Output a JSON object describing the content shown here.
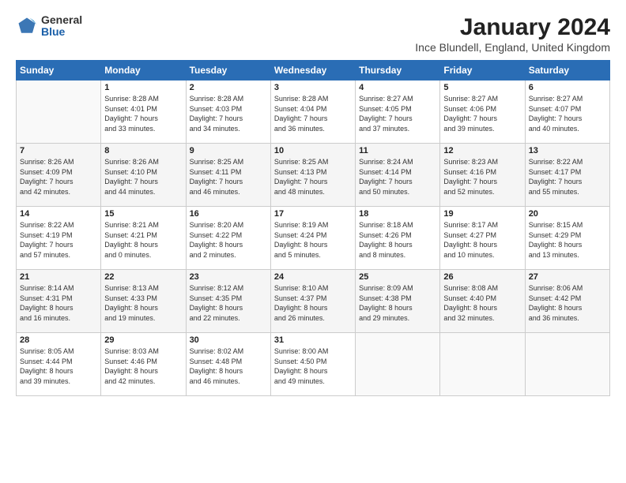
{
  "header": {
    "logo_general": "General",
    "logo_blue": "Blue",
    "title": "January 2024",
    "subtitle": "Ince Blundell, England, United Kingdom"
  },
  "days_of_week": [
    "Sunday",
    "Monday",
    "Tuesday",
    "Wednesday",
    "Thursday",
    "Friday",
    "Saturday"
  ],
  "weeks": [
    [
      {
        "day": "",
        "content": ""
      },
      {
        "day": "1",
        "content": "Sunrise: 8:28 AM\nSunset: 4:01 PM\nDaylight: 7 hours\nand 33 minutes."
      },
      {
        "day": "2",
        "content": "Sunrise: 8:28 AM\nSunset: 4:03 PM\nDaylight: 7 hours\nand 34 minutes."
      },
      {
        "day": "3",
        "content": "Sunrise: 8:28 AM\nSunset: 4:04 PM\nDaylight: 7 hours\nand 36 minutes."
      },
      {
        "day": "4",
        "content": "Sunrise: 8:27 AM\nSunset: 4:05 PM\nDaylight: 7 hours\nand 37 minutes."
      },
      {
        "day": "5",
        "content": "Sunrise: 8:27 AM\nSunset: 4:06 PM\nDaylight: 7 hours\nand 39 minutes."
      },
      {
        "day": "6",
        "content": "Sunrise: 8:27 AM\nSunset: 4:07 PM\nDaylight: 7 hours\nand 40 minutes."
      }
    ],
    [
      {
        "day": "7",
        "content": "Sunrise: 8:26 AM\nSunset: 4:09 PM\nDaylight: 7 hours\nand 42 minutes."
      },
      {
        "day": "8",
        "content": "Sunrise: 8:26 AM\nSunset: 4:10 PM\nDaylight: 7 hours\nand 44 minutes."
      },
      {
        "day": "9",
        "content": "Sunrise: 8:25 AM\nSunset: 4:11 PM\nDaylight: 7 hours\nand 46 minutes."
      },
      {
        "day": "10",
        "content": "Sunrise: 8:25 AM\nSunset: 4:13 PM\nDaylight: 7 hours\nand 48 minutes."
      },
      {
        "day": "11",
        "content": "Sunrise: 8:24 AM\nSunset: 4:14 PM\nDaylight: 7 hours\nand 50 minutes."
      },
      {
        "day": "12",
        "content": "Sunrise: 8:23 AM\nSunset: 4:16 PM\nDaylight: 7 hours\nand 52 minutes."
      },
      {
        "day": "13",
        "content": "Sunrise: 8:22 AM\nSunset: 4:17 PM\nDaylight: 7 hours\nand 55 minutes."
      }
    ],
    [
      {
        "day": "14",
        "content": "Sunrise: 8:22 AM\nSunset: 4:19 PM\nDaylight: 7 hours\nand 57 minutes."
      },
      {
        "day": "15",
        "content": "Sunrise: 8:21 AM\nSunset: 4:21 PM\nDaylight: 8 hours\nand 0 minutes."
      },
      {
        "day": "16",
        "content": "Sunrise: 8:20 AM\nSunset: 4:22 PM\nDaylight: 8 hours\nand 2 minutes."
      },
      {
        "day": "17",
        "content": "Sunrise: 8:19 AM\nSunset: 4:24 PM\nDaylight: 8 hours\nand 5 minutes."
      },
      {
        "day": "18",
        "content": "Sunrise: 8:18 AM\nSunset: 4:26 PM\nDaylight: 8 hours\nand 8 minutes."
      },
      {
        "day": "19",
        "content": "Sunrise: 8:17 AM\nSunset: 4:27 PM\nDaylight: 8 hours\nand 10 minutes."
      },
      {
        "day": "20",
        "content": "Sunrise: 8:15 AM\nSunset: 4:29 PM\nDaylight: 8 hours\nand 13 minutes."
      }
    ],
    [
      {
        "day": "21",
        "content": "Sunrise: 8:14 AM\nSunset: 4:31 PM\nDaylight: 8 hours\nand 16 minutes."
      },
      {
        "day": "22",
        "content": "Sunrise: 8:13 AM\nSunset: 4:33 PM\nDaylight: 8 hours\nand 19 minutes."
      },
      {
        "day": "23",
        "content": "Sunrise: 8:12 AM\nSunset: 4:35 PM\nDaylight: 8 hours\nand 22 minutes."
      },
      {
        "day": "24",
        "content": "Sunrise: 8:10 AM\nSunset: 4:37 PM\nDaylight: 8 hours\nand 26 minutes."
      },
      {
        "day": "25",
        "content": "Sunrise: 8:09 AM\nSunset: 4:38 PM\nDaylight: 8 hours\nand 29 minutes."
      },
      {
        "day": "26",
        "content": "Sunrise: 8:08 AM\nSunset: 4:40 PM\nDaylight: 8 hours\nand 32 minutes."
      },
      {
        "day": "27",
        "content": "Sunrise: 8:06 AM\nSunset: 4:42 PM\nDaylight: 8 hours\nand 36 minutes."
      }
    ],
    [
      {
        "day": "28",
        "content": "Sunrise: 8:05 AM\nSunset: 4:44 PM\nDaylight: 8 hours\nand 39 minutes."
      },
      {
        "day": "29",
        "content": "Sunrise: 8:03 AM\nSunset: 4:46 PM\nDaylight: 8 hours\nand 42 minutes."
      },
      {
        "day": "30",
        "content": "Sunrise: 8:02 AM\nSunset: 4:48 PM\nDaylight: 8 hours\nand 46 minutes."
      },
      {
        "day": "31",
        "content": "Sunrise: 8:00 AM\nSunset: 4:50 PM\nDaylight: 8 hours\nand 49 minutes."
      },
      {
        "day": "",
        "content": ""
      },
      {
        "day": "",
        "content": ""
      },
      {
        "day": "",
        "content": ""
      }
    ]
  ]
}
